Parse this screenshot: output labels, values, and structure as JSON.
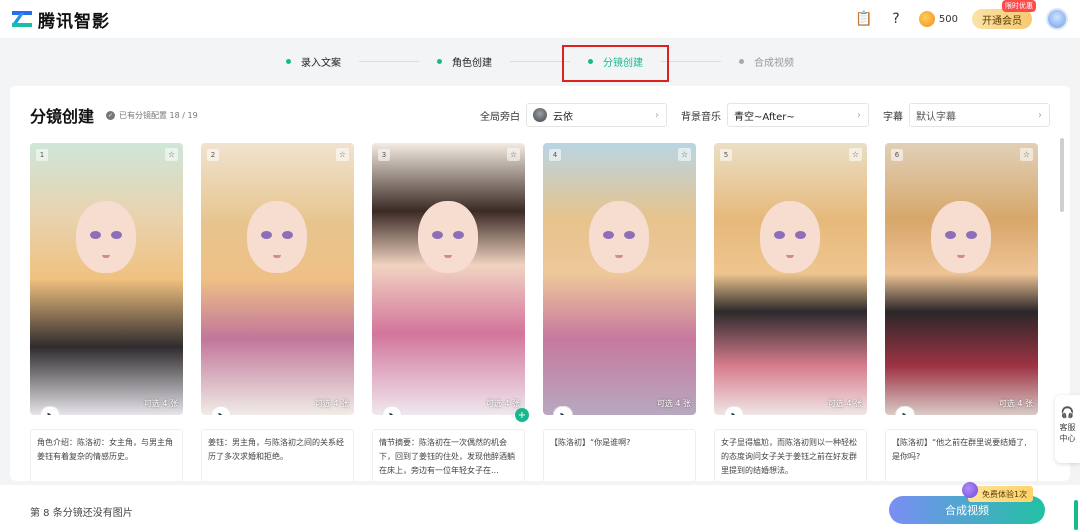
{
  "header": {
    "app_name": "腾讯智影",
    "coin_count": "500",
    "vip_label": "开通会员",
    "vip_badge": "限时优惠"
  },
  "steps": [
    {
      "label": "录入文案",
      "state": "done"
    },
    {
      "label": "角色创建",
      "state": "done"
    },
    {
      "label": "分镜创建",
      "state": "active"
    },
    {
      "label": "合成视频",
      "state": "inactive"
    }
  ],
  "panel": {
    "title": "分镜创建",
    "status": "已有分镜配置 18 / 19",
    "voice_label": "全局旁白",
    "voice_value": "云依",
    "music_label": "背景音乐",
    "music_value": "青空~After~",
    "subtitle_label": "字幕",
    "subtitle_value": "默认字幕"
  },
  "cards": [
    {
      "num": "1",
      "avail": "可选 4 张",
      "text": "角色介绍：陈洛初：女主角，与男主角姜钰有着复杂的情感历史。"
    },
    {
      "num": "2",
      "avail": "可选 4 张",
      "text": "姜钰：男主角，与陈洛初之间的关系经历了多次求婚和拒绝。"
    },
    {
      "num": "3",
      "avail": "可选 4 张",
      "text": "情节摘要：陈洛初在一次偶然的机会下，回到了姜钰的住处，发现他醉酒躺在床上，旁边有一位年轻女子在..."
    },
    {
      "num": "4",
      "avail": "可选 4 张",
      "text": "【陈洛初】“你是谁啊?"
    },
    {
      "num": "5",
      "avail": "可选 4 张",
      "text": "女子显得尴尬，而陈洛初则以一种轻松的态度询问女子关于姜钰之前在好友群里提到的结婚想法。"
    },
    {
      "num": "6",
      "avail": "可选 4 张",
      "text": "【陈洛初】“他之前在群里说要结婚了,是你吗?"
    }
  ],
  "service": {
    "line1": "客服",
    "line2": "中心"
  },
  "bottom": {
    "notice": "第 8 条分镜还没有图片",
    "compose_label": "合成视频",
    "trial_label": "免费体验1次"
  },
  "colors": {
    "accent": "#17b890",
    "highlight_box": "#e02020"
  }
}
